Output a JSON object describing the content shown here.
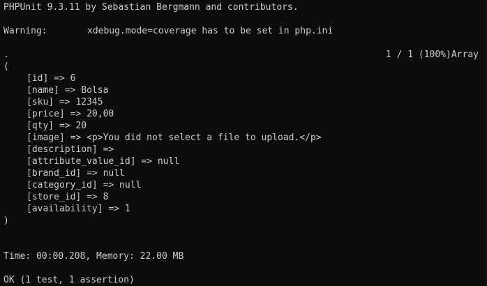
{
  "header": {
    "version_line": "PHPUnit 9.3.11 by Sebastian Bergmann and contributors."
  },
  "warning": {
    "label": "Warning:",
    "message": "xdebug.mode=coverage has to be set in php.ini"
  },
  "progress": {
    "dots": ".",
    "status": "1 / 1 (100%)Array"
  },
  "array_dump": {
    "open": "(",
    "entries": [
      "[id] => 6",
      "[name] => Bolsa",
      "[sku] => 12345",
      "[price] => 20,00",
      "[qty] => 20",
      "[image] => <p>You did not select a file to upload.</p>",
      "[description] =>",
      "[attribute_value_id] => null",
      "[brand_id] => null",
      "[category_id] => null",
      "[store_id] => 8",
      "[availability] => 1"
    ],
    "close": ")"
  },
  "summary": {
    "time_memory": "Time: 00:00.208, Memory: 22.00 MB",
    "result": "OK (1 test, 1 assertion)"
  },
  "colors": {
    "background": "#0c0c0c",
    "foreground": "#cccccc"
  }
}
